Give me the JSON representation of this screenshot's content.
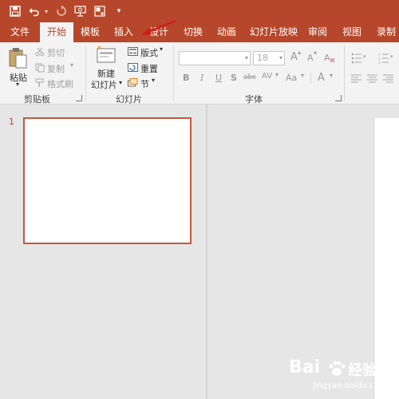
{
  "quick_access": {
    "icons": [
      "save-icon",
      "undo-icon",
      "redo-icon",
      "start-from-beginning-icon",
      "touch-mode-icon",
      "customize-caret-icon"
    ]
  },
  "tabs": [
    {
      "label": "文件",
      "active": false
    },
    {
      "label": "开始",
      "active": true
    },
    {
      "label": "模板",
      "active": false
    },
    {
      "label": "插入",
      "active": false,
      "highlighted": true
    },
    {
      "label": "设计",
      "active": false
    },
    {
      "label": "切换",
      "active": false
    },
    {
      "label": "动画",
      "active": false
    },
    {
      "label": "幻灯片放映",
      "active": false
    },
    {
      "label": "审阅",
      "active": false
    },
    {
      "label": "视图",
      "active": false
    },
    {
      "label": "录制",
      "active": false
    }
  ],
  "ribbon": {
    "clipboard": {
      "paste": "粘贴",
      "cut": "剪切",
      "copy": "复制",
      "format_painter": "格式刷",
      "group_label": "剪贴板"
    },
    "slides": {
      "new_slide_line1": "新建",
      "new_slide_line2": "幻灯片",
      "layout": "版式",
      "reset": "重置",
      "section": "节",
      "group_label": "幻灯片"
    },
    "font": {
      "font_name": "",
      "font_size": "18",
      "grow": "A",
      "shrink": "A",
      "bold": "B",
      "italic": "I",
      "underline": "U",
      "shadow": "S",
      "strikethrough": "abc",
      "spacing": "AV",
      "change_case": "Aa",
      "font_color": "A",
      "group_label": "字体"
    }
  },
  "slides": [
    {
      "number": "1"
    }
  ],
  "watermark": {
    "brand": "Bai",
    "brand2": "经验",
    "url": "jingyan.baidu.com"
  },
  "colors": {
    "accent": "#b7472a",
    "highlight_box": "#d01c1c",
    "thumb_border": "#c25a3d"
  }
}
